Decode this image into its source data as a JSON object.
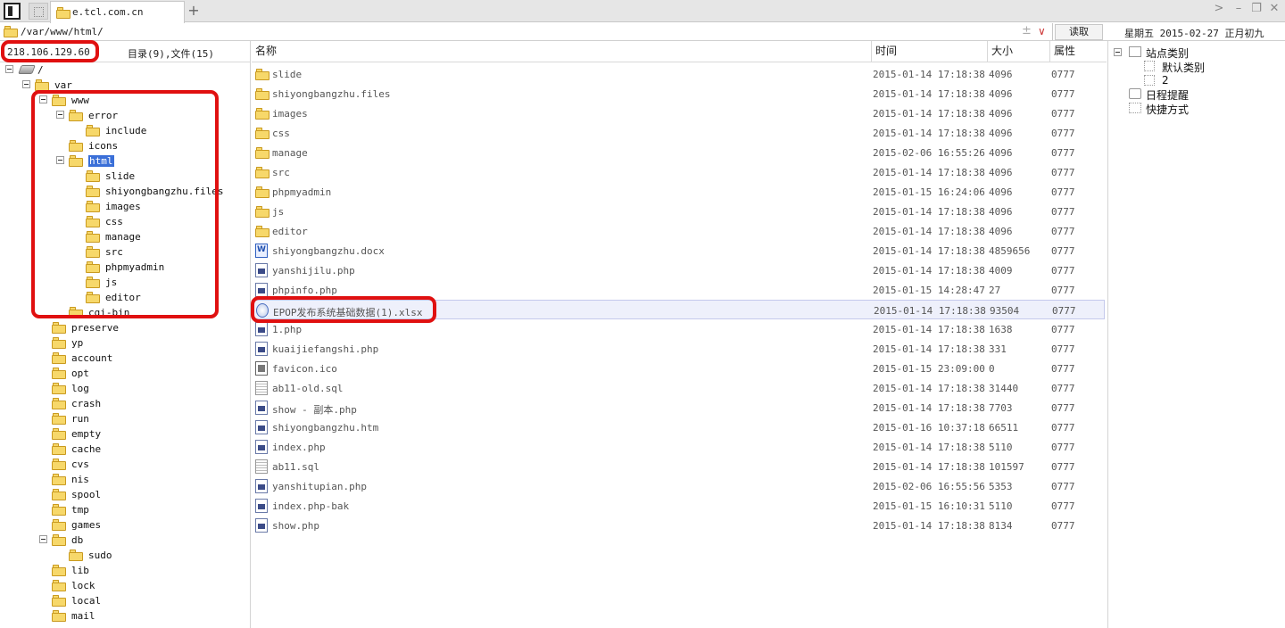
{
  "tab": {
    "title": "e.tcl.com.cn"
  },
  "address": {
    "path": "/var/www/html/",
    "read_label": "读取"
  },
  "datetime": "星期五 2015-02-27 正月初九",
  "left_panel": {
    "ip": "218.106.129.60",
    "summary": "目录(9),文件(15)",
    "tree": [
      {
        "label": "/",
        "depth": 0,
        "expanded": true,
        "kind": "drive"
      },
      {
        "label": "var",
        "depth": 1,
        "expanded": true
      },
      {
        "label": "www",
        "depth": 2,
        "expanded": true
      },
      {
        "label": "error",
        "depth": 3,
        "expanded": true
      },
      {
        "label": "include",
        "depth": 4
      },
      {
        "label": "icons",
        "depth": 3
      },
      {
        "label": "html",
        "depth": 3,
        "expanded": true,
        "selected": true
      },
      {
        "label": "slide",
        "depth": 4
      },
      {
        "label": "shiyongbangzhu.files",
        "depth": 4
      },
      {
        "label": "images",
        "depth": 4
      },
      {
        "label": "css",
        "depth": 4
      },
      {
        "label": "manage",
        "depth": 4
      },
      {
        "label": "src",
        "depth": 4
      },
      {
        "label": "phpmyadmin",
        "depth": 4
      },
      {
        "label": "js",
        "depth": 4
      },
      {
        "label": "editor",
        "depth": 4
      },
      {
        "label": "cgi-bin",
        "depth": 3
      },
      {
        "label": "preserve",
        "depth": 2
      },
      {
        "label": "yp",
        "depth": 2
      },
      {
        "label": "account",
        "depth": 2
      },
      {
        "label": "opt",
        "depth": 2
      },
      {
        "label": "log",
        "depth": 2
      },
      {
        "label": "crash",
        "depth": 2
      },
      {
        "label": "run",
        "depth": 2
      },
      {
        "label": "empty",
        "depth": 2
      },
      {
        "label": "cache",
        "depth": 2
      },
      {
        "label": "cvs",
        "depth": 2
      },
      {
        "label": "nis",
        "depth": 2
      },
      {
        "label": "spool",
        "depth": 2
      },
      {
        "label": "tmp",
        "depth": 2
      },
      {
        "label": "games",
        "depth": 2
      },
      {
        "label": "db",
        "depth": 2,
        "expanded": true
      },
      {
        "label": "sudo",
        "depth": 3
      },
      {
        "label": "lib",
        "depth": 2
      },
      {
        "label": "lock",
        "depth": 2
      },
      {
        "label": "local",
        "depth": 2
      },
      {
        "label": "mail",
        "depth": 2
      }
    ]
  },
  "columns": {
    "name": "名称",
    "time": "时间",
    "size": "大小",
    "attr": "属性"
  },
  "files": [
    {
      "name": "slide",
      "time": "2015-01-14 17:18:38",
      "size": "4096",
      "attr": "0777",
      "type": "folder"
    },
    {
      "name": "shiyongbangzhu.files",
      "time": "2015-01-14 17:18:38",
      "size": "4096",
      "attr": "0777",
      "type": "folder"
    },
    {
      "name": "images",
      "time": "2015-01-14 17:18:38",
      "size": "4096",
      "attr": "0777",
      "type": "folder"
    },
    {
      "name": "css",
      "time": "2015-01-14 17:18:38",
      "size": "4096",
      "attr": "0777",
      "type": "folder"
    },
    {
      "name": "manage",
      "time": "2015-02-06 16:55:26",
      "size": "4096",
      "attr": "0777",
      "type": "folder"
    },
    {
      "name": "src",
      "time": "2015-01-14 17:18:38",
      "size": "4096",
      "attr": "0777",
      "type": "folder"
    },
    {
      "name": "phpmyadmin",
      "time": "2015-01-15 16:24:06",
      "size": "4096",
      "attr": "0777",
      "type": "folder"
    },
    {
      "name": "js",
      "time": "2015-01-14 17:18:38",
      "size": "4096",
      "attr": "0777",
      "type": "folder"
    },
    {
      "name": "editor",
      "time": "2015-01-14 17:18:38",
      "size": "4096",
      "attr": "0777",
      "type": "folder"
    },
    {
      "name": "shiyongbangzhu.docx",
      "time": "2015-01-14 17:18:38",
      "size": "4859656",
      "attr": "0777",
      "type": "doc"
    },
    {
      "name": "yanshijilu.php",
      "time": "2015-01-14 17:18:38",
      "size": "4009",
      "attr": "0777",
      "type": "php"
    },
    {
      "name": "phpinfo.php",
      "time": "2015-01-15 14:28:47",
      "size": "27",
      "attr": "0777",
      "type": "php"
    },
    {
      "name": "EPOP发布系统基础数据(1).xlsx",
      "time": "2015-01-14 17:18:38",
      "size": "93504",
      "attr": "0777",
      "type": "xls",
      "selected": true
    },
    {
      "name": "1.php",
      "time": "2015-01-14 17:18:38",
      "size": "1638",
      "attr": "0777",
      "type": "php"
    },
    {
      "name": "kuaijiefangshi.php",
      "time": "2015-01-14 17:18:38",
      "size": "331",
      "attr": "0777",
      "type": "php"
    },
    {
      "name": "favicon.ico",
      "time": "2015-01-15 23:09:00",
      "size": "0",
      "attr": "0777",
      "type": "ico"
    },
    {
      "name": "ab11-old.sql",
      "time": "2015-01-14 17:18:38",
      "size": "31440",
      "attr": "0777",
      "type": "sql"
    },
    {
      "name": "show - 副本.php",
      "time": "2015-01-14 17:18:38",
      "size": "7703",
      "attr": "0777",
      "type": "php"
    },
    {
      "name": "shiyongbangzhu.htm",
      "time": "2015-01-16 10:37:18",
      "size": "66511",
      "attr": "0777",
      "type": "php"
    },
    {
      "name": "index.php",
      "time": "2015-01-14 17:18:38",
      "size": "5110",
      "attr": "0777",
      "type": "php"
    },
    {
      "name": "ab11.sql",
      "time": "2015-01-14 17:18:38",
      "size": "101597",
      "attr": "0777",
      "type": "sql"
    },
    {
      "name": "yanshitupian.php",
      "time": "2015-02-06 16:55:56",
      "size": "5353",
      "attr": "0777",
      "type": "php"
    },
    {
      "name": "index.php-bak",
      "time": "2015-01-15 16:10:31",
      "size": "5110",
      "attr": "0777",
      "type": "php"
    },
    {
      "name": "show.php",
      "time": "2015-01-14 17:18:38",
      "size": "8134",
      "attr": "0777",
      "type": "php"
    }
  ],
  "right_panel": {
    "site_category": "站点类别",
    "default_category": "默认类别",
    "item2": "2",
    "schedule": "日程提醒",
    "shortcut": "快捷方式"
  },
  "colors": {
    "highlight": "#e01010",
    "selection": "#3a6fd8",
    "folder": "#f7d86a"
  }
}
